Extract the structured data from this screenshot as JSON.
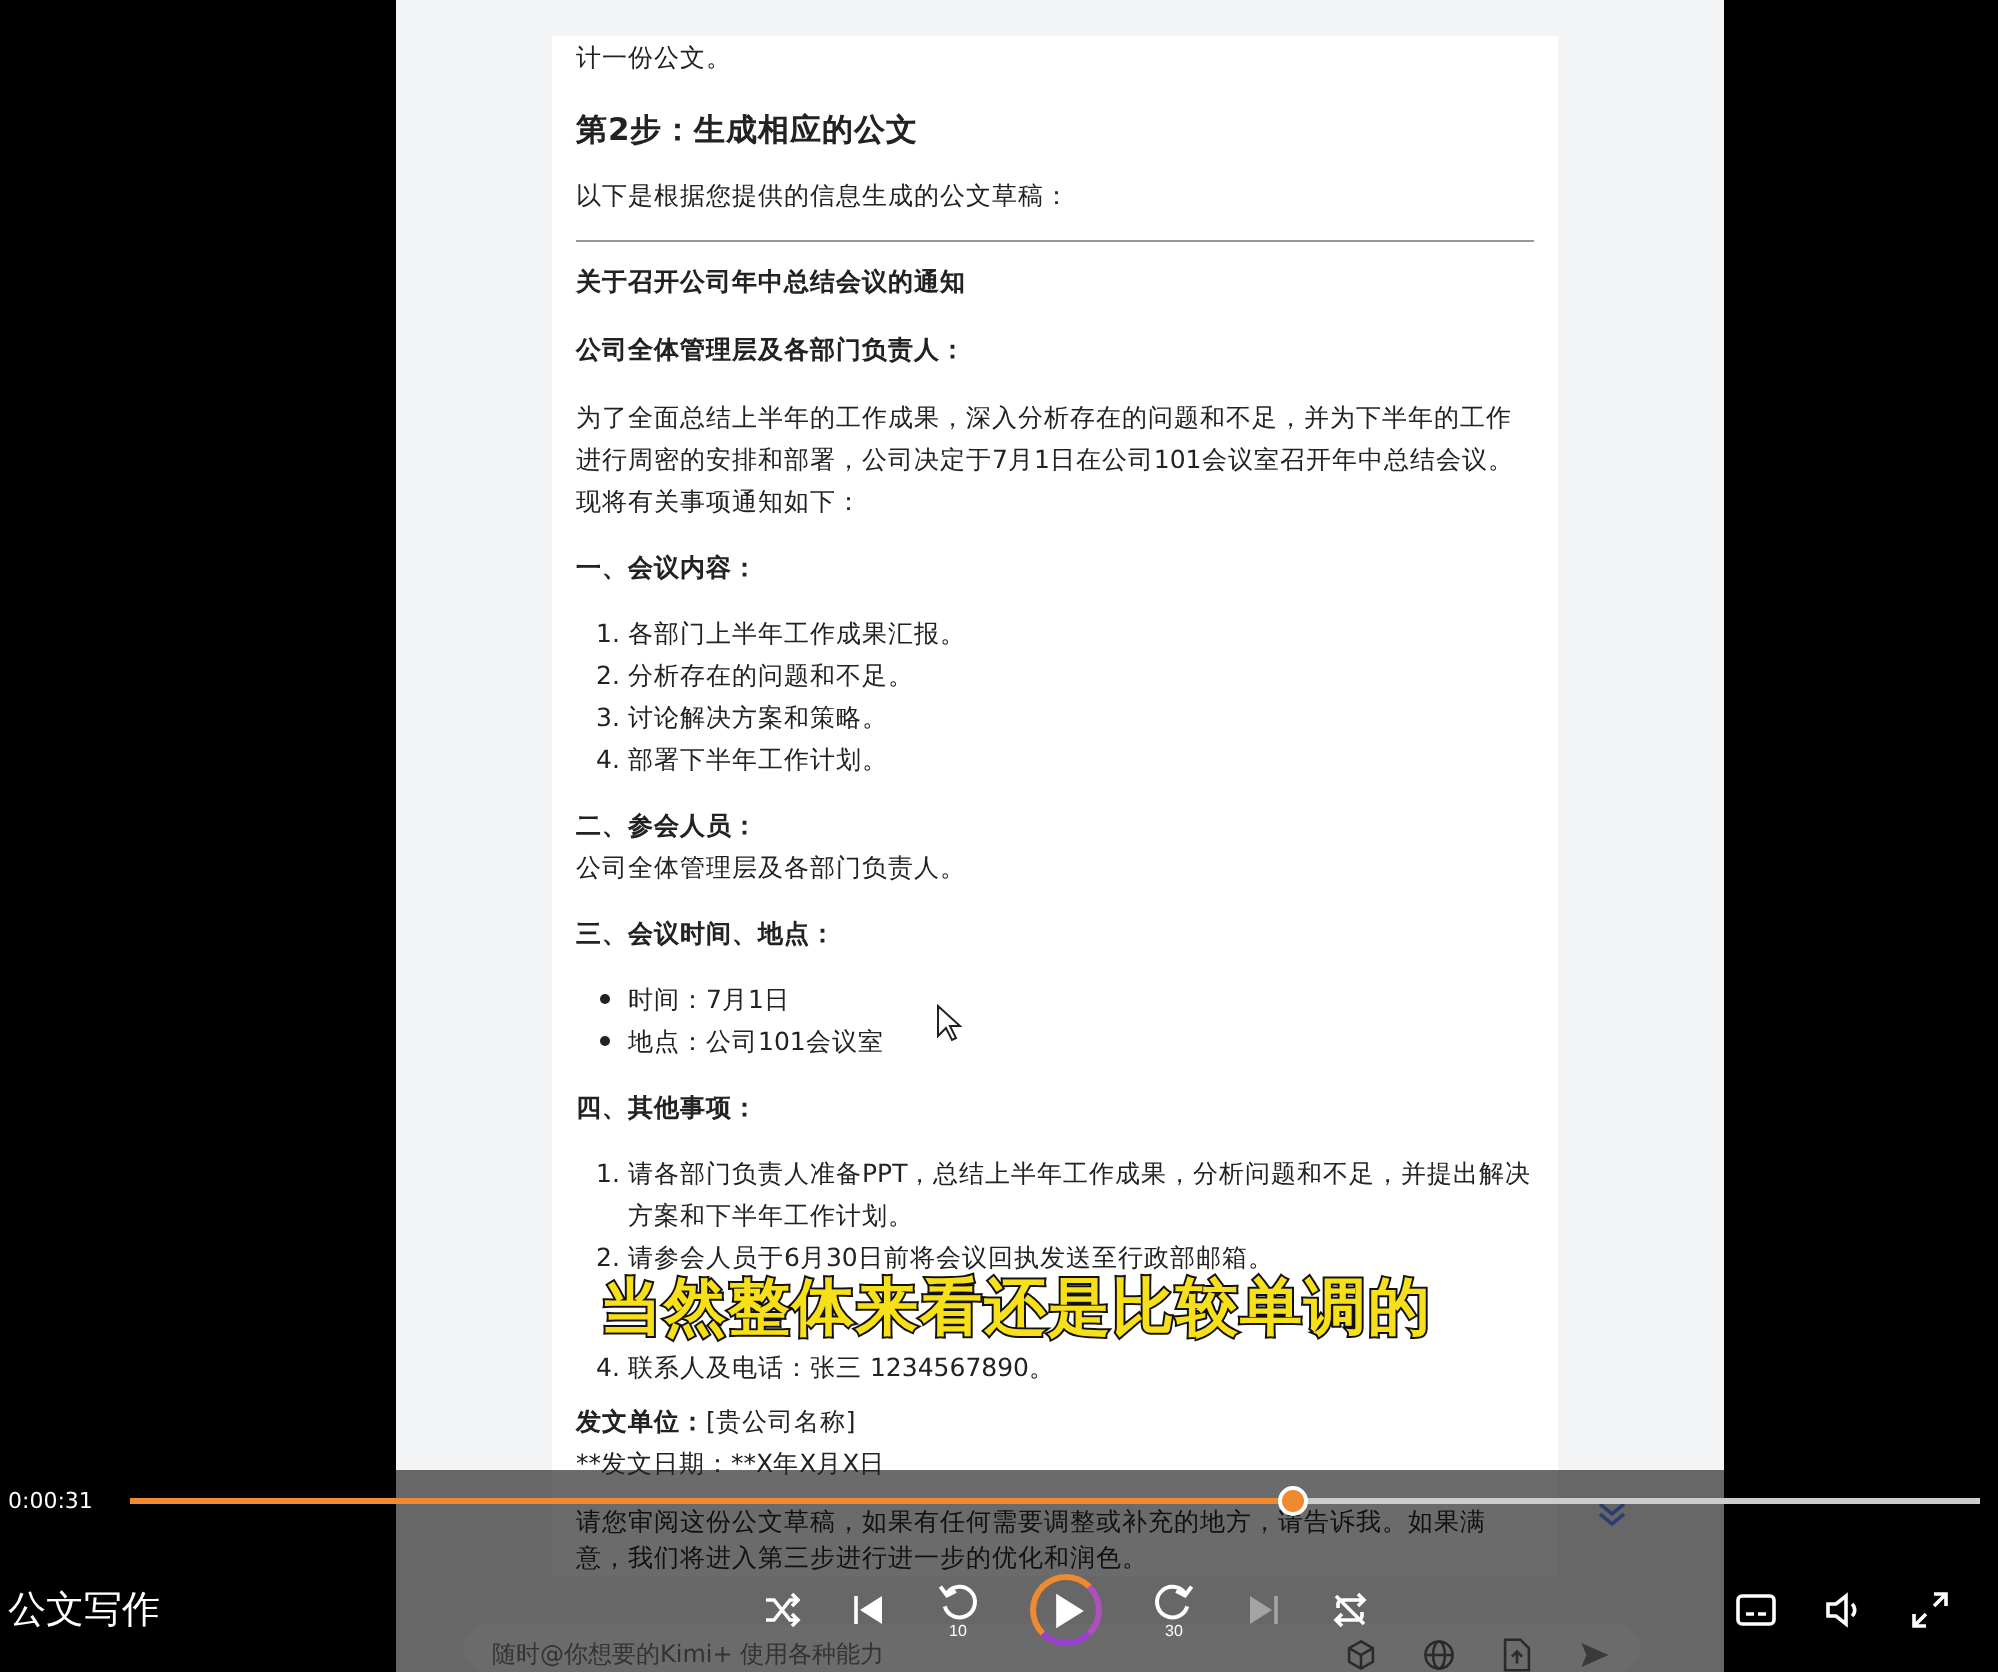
{
  "video_frame": {
    "top_line": "计一份公文。",
    "heading": "第2步：生成相应的公文",
    "intro": "以下是根据您提供的信息生成的公文草稿：",
    "notice_title": "关于召开公司年中总结会议的通知",
    "greeting": "公司全体管理层及各部门负责人：",
    "paragraph": "为了全面总结上半年的工作成果，深入分析存在的问题和不足，并为下半年的工作进行周密的安排和部署，公司决定于7月1日在公司101会议室召开年中总结会议。现将有关事项通知如下：",
    "sections": [
      {
        "heading": "一、会议内容：",
        "kind": "ordered",
        "items": [
          {
            "number": "1.",
            "text": "各部门上半年工作成果汇报。"
          },
          {
            "number": "2.",
            "text": "分析存在的问题和不足。"
          },
          {
            "number": "3.",
            "text": "讨论解决方案和策略。"
          },
          {
            "number": "4.",
            "text": "部署下半年工作计划。"
          }
        ]
      },
      {
        "heading": "二、参会人员：",
        "kind": "text",
        "text": "公司全体管理层及各部门负责人。"
      },
      {
        "heading": "三、会议时间、地点：",
        "kind": "bullets",
        "items": [
          {
            "text": "时间：7月1日"
          },
          {
            "text": "地点：公司101会议室"
          }
        ]
      },
      {
        "heading": "四、其他事项：",
        "kind": "ordered",
        "items": [
          {
            "number": "1.",
            "text": "请各部门负责人准备PPT，总结上半年工作成果，分析问题和不足，并提出解决方案和下半年工作计划。"
          },
          {
            "number": "2.",
            "text": "请参会人员于6月30日前将会议回执发送至行政部邮箱。"
          },
          {
            "number": "4.",
            "text": "联系人及电话：张三 1234567890。"
          }
        ]
      }
    ],
    "issuer_label": "发文单位：",
    "issuer": "[贵公司名称]",
    "date_line": "**发文日期：**X年X月X日",
    "follow_up": "请您审阅这份公文草稿，如果有任何需要调整或补充的地方，请告诉我。如果满意，我们将进入第三步进行进一步的优化和润色。",
    "input": {
      "placeholder": "随时@你想要的Kimi+ 使用各种能力"
    }
  },
  "subtitle": "当然整体来看还是比较单调的",
  "player": {
    "time": "0:00:31",
    "rewind_seconds": "10",
    "forward_seconds": "30",
    "level": 0.628,
    "title": "公文写作",
    "playing": false,
    "next_disabled": true
  }
}
